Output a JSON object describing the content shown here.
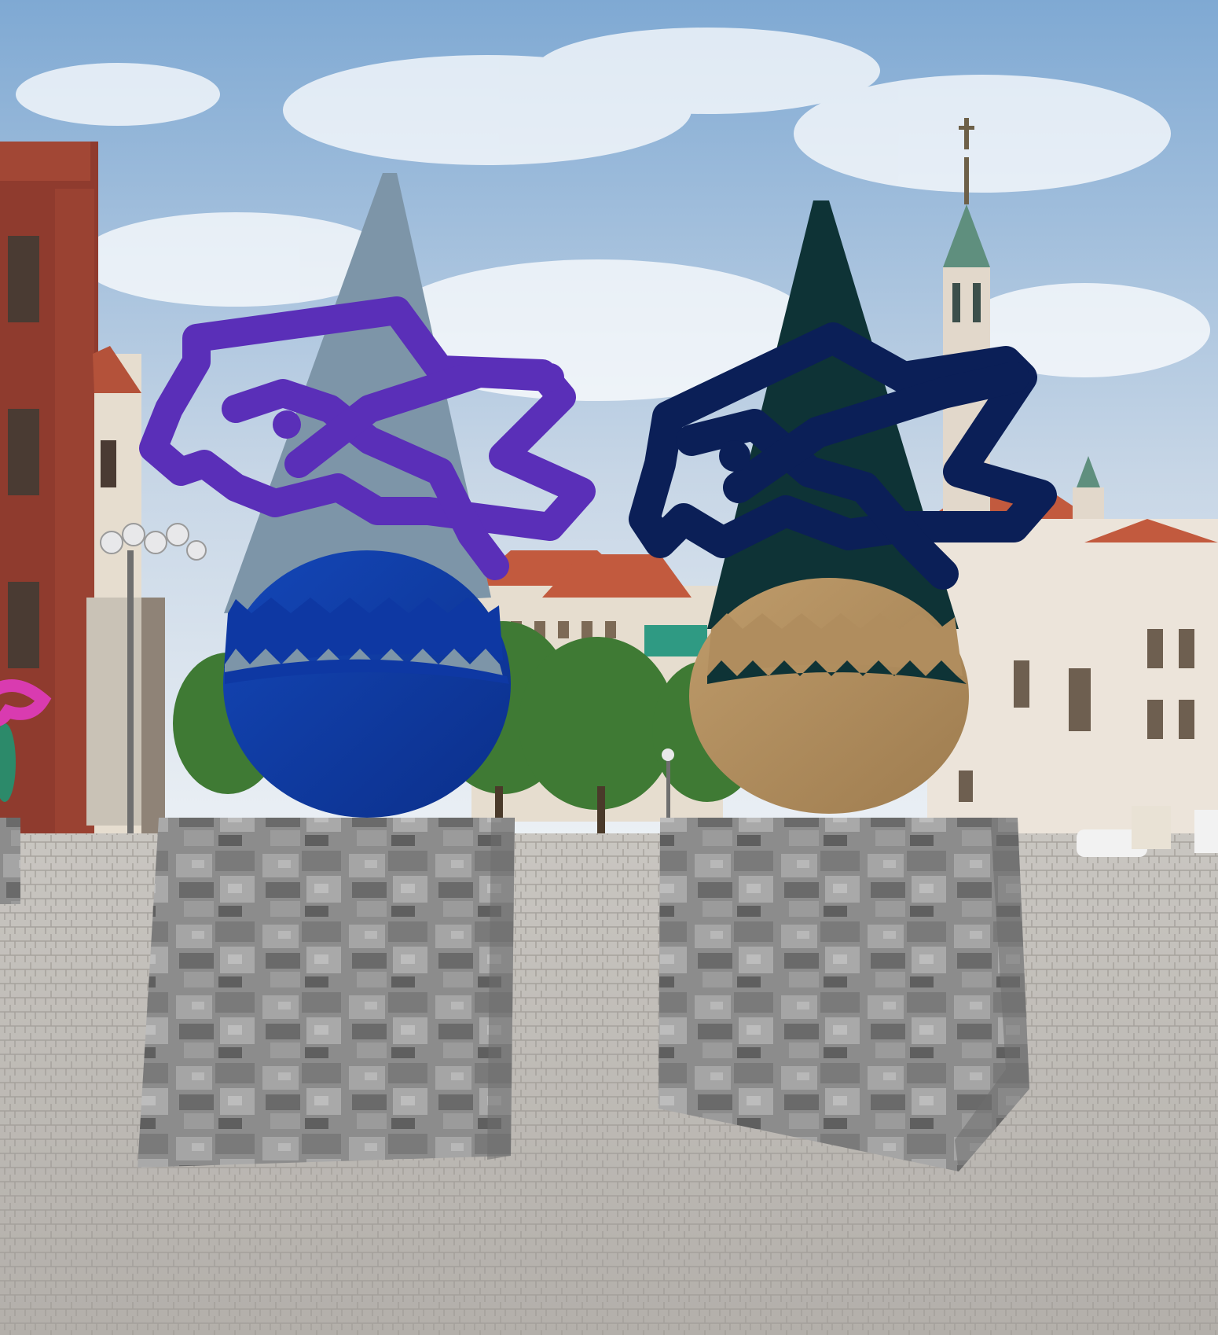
{
  "scene": {
    "kind": "AR composite render",
    "colors": {
      "sky_top": "#7fa9d3",
      "sky_bottom": "#eef2f6",
      "cloud": "#ffffff",
      "pavement": "#bfbcb8",
      "pavement_dark": "#a8a5a1",
      "building_red": "#8f3b2e",
      "building_cream": "#e6ddcf",
      "church_white": "#ece4da",
      "roof_red": "#c25a3e",
      "copper_green": "#5f8f7e",
      "tree_green": "#3f7a34",
      "stone_light": "#a9a9a9",
      "stone_mid": "#8c8c8c",
      "stone_dark": "#5e5e5e"
    }
  },
  "statues": [
    {
      "id": "left",
      "cone_color": "#7d95a8",
      "knot_color": "#5a2fb8",
      "band_color": "#113da8",
      "ball_color": "#0e38a3",
      "zigzag_color": "#7d95a8"
    },
    {
      "id": "right",
      "cone_color": "#0e3336",
      "knot_color": "#0b1f57",
      "band_color": "#b08d5e",
      "ball_color": "#b08d5e",
      "zigzag_color": "#0e3336"
    }
  ],
  "edge_statue": {
    "knot_color": "#d93bb0",
    "body_color": "#2c8a6a"
  }
}
